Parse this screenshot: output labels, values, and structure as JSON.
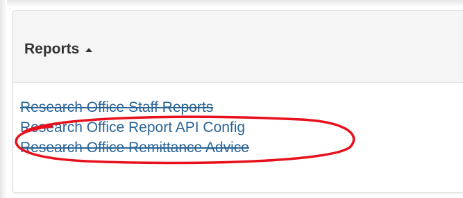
{
  "panel": {
    "title": "Reports",
    "caret_icon": "caret-up-icon"
  },
  "reports": {
    "items": [
      {
        "label": "Research Office Staff Reports"
      },
      {
        "label": "Research Office Report API Config"
      },
      {
        "label": "Research Office Remittance Advice"
      }
    ]
  },
  "colors": {
    "link": "#2a6496",
    "highlight_ellipse": "#e8101c",
    "heading_bg": "#f5f5f5"
  }
}
